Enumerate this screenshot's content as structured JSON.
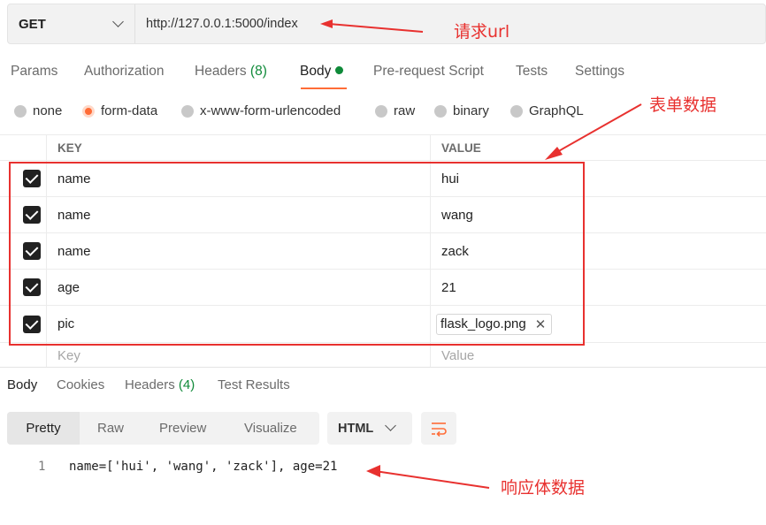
{
  "request": {
    "method": "GET",
    "url": "http://127.0.0.1:5000/index"
  },
  "request_tabs": [
    {
      "label": "Params",
      "count": ""
    },
    {
      "label": "Authorization",
      "count": ""
    },
    {
      "label": "Headers",
      "count": "(8)"
    },
    {
      "label": "Body",
      "count": ""
    },
    {
      "label": "Pre-request Script",
      "count": ""
    },
    {
      "label": "Tests",
      "count": ""
    },
    {
      "label": "Settings",
      "count": ""
    }
  ],
  "body_types": [
    {
      "label": "none",
      "selected": false
    },
    {
      "label": "form-data",
      "selected": true
    },
    {
      "label": "x-www-form-urlencoded",
      "selected": false
    },
    {
      "label": "raw",
      "selected": false
    },
    {
      "label": "binary",
      "selected": false
    },
    {
      "label": "GraphQL",
      "selected": false
    }
  ],
  "table": {
    "key_header": "KEY",
    "value_header": "VALUE",
    "rows": [
      {
        "key": "name",
        "value": "hui",
        "checked": true
      },
      {
        "key": "name",
        "value": "wang",
        "checked": true
      },
      {
        "key": "name",
        "value": "zack",
        "checked": true
      },
      {
        "key": "age",
        "value": "21",
        "checked": true
      },
      {
        "key": "pic",
        "value": "flask_logo.png",
        "checked": true,
        "file_remove_glyph": "✕"
      }
    ],
    "key_placeholder": "Key",
    "value_placeholder": "Value"
  },
  "response_tabs": [
    {
      "label": "Body",
      "count": ""
    },
    {
      "label": "Cookies",
      "count": ""
    },
    {
      "label": "Headers",
      "count": "(4)"
    },
    {
      "label": "Test Results",
      "count": ""
    }
  ],
  "view_modes": [
    "Pretty",
    "Raw",
    "Preview",
    "Visualize"
  ],
  "format": "HTML",
  "response_body": [
    {
      "line": "1",
      "text": "name=['hui', 'wang', 'zack'], age=21"
    }
  ],
  "annotations": {
    "url": "请求url",
    "form": "表单数据",
    "response": "响应体数据"
  },
  "colors": {
    "accent": "#ff6c37",
    "green": "#0f8a39",
    "annotation_red": "#e8312f"
  }
}
